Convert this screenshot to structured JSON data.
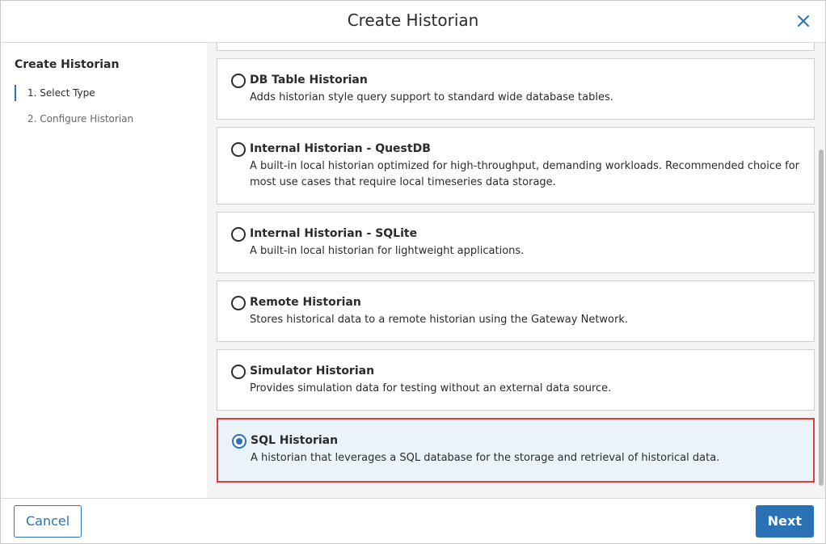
{
  "header": {
    "title": "Create Historian",
    "close_icon": "close-icon"
  },
  "sidebar": {
    "title": "Create Historian",
    "steps": [
      {
        "label": "1. Select Type",
        "active": true
      },
      {
        "label": "2. Configure Historian",
        "active": false
      }
    ]
  },
  "options": [
    {
      "name": "",
      "desc": "",
      "selected": false
    },
    {
      "name": "DB Table Historian",
      "desc": "Adds historian style query support to standard wide database tables.",
      "selected": false
    },
    {
      "name": "Internal Historian - QuestDB",
      "desc": "A built-in local historian optimized for high-throughput, demanding workloads. Recommended choice for most use cases that require local timeseries data storage.",
      "selected": false
    },
    {
      "name": "Internal Historian - SQLite",
      "desc": "A built-in local historian for lightweight applications.",
      "selected": false
    },
    {
      "name": "Remote Historian",
      "desc": "Stores historical data to a remote historian using the Gateway Network.",
      "selected": false
    },
    {
      "name": "Simulator Historian",
      "desc": "Provides simulation data for testing without an external data source.",
      "selected": false
    },
    {
      "name": "SQL Historian",
      "desc": "A historian that leverages a SQL database for the storage and retrieval of historical data.",
      "selected": true
    }
  ],
  "footer": {
    "cancel_label": "Cancel",
    "next_label": "Next"
  },
  "colors": {
    "accent": "#2a72b5",
    "highlight_border": "#e0393e",
    "selected_bg": "#eaf3f9"
  }
}
